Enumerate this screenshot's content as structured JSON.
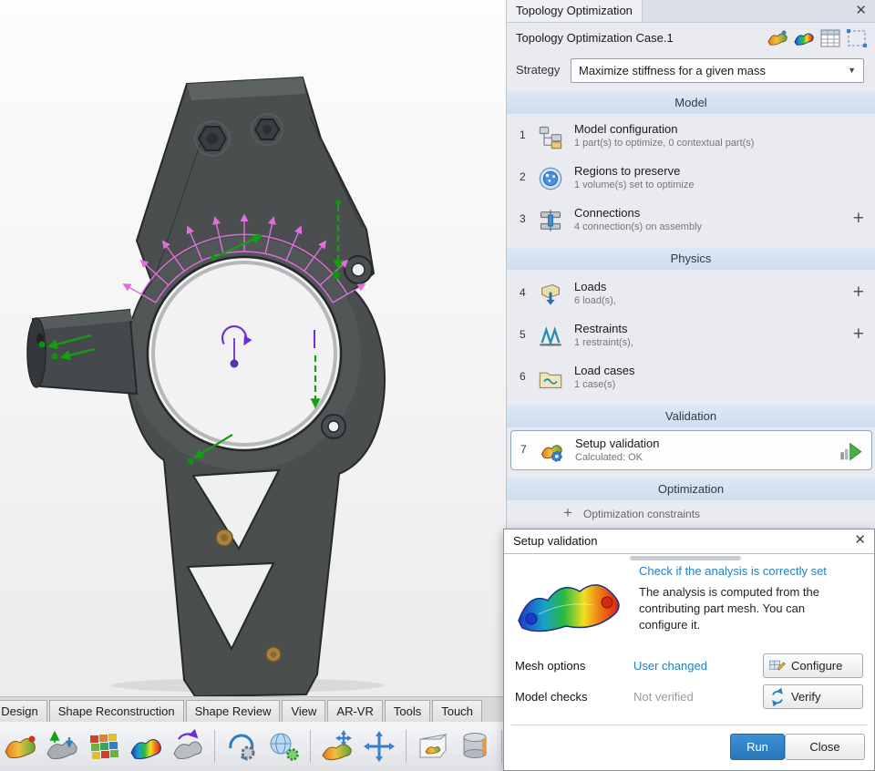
{
  "icons": {
    "close": "✕",
    "dropdown_arrow": "▼",
    "plus": "+"
  },
  "panel": {
    "title": "Topology Optimization",
    "case_title": "Topology Optimization Case.1",
    "strategy_label": "Strategy",
    "strategy_value": "Maximize stiffness for a given mass",
    "sections": {
      "model": {
        "title": "Model"
      },
      "physics": {
        "title": "Physics"
      },
      "validation": {
        "title": "Validation"
      },
      "optimization": {
        "title": "Optimization"
      }
    },
    "items": [
      {
        "num": "1",
        "label": "Model configuration",
        "sub": "1 part(s) to optimize, 0 contextual part(s)"
      },
      {
        "num": "2",
        "label": "Regions to preserve",
        "sub": "1 volume(s) set to optimize"
      },
      {
        "num": "3",
        "label": "Connections",
        "sub": "4 connection(s) on assembly"
      },
      {
        "num": "4",
        "label": "Loads",
        "sub": "6 load(s),"
      },
      {
        "num": "5",
        "label": "Restraints",
        "sub": "1 restraint(s),"
      },
      {
        "num": "6",
        "label": "Load cases",
        "sub": "1 case(s)"
      },
      {
        "num": "7",
        "label": "Setup validation",
        "sub": "Calculated: OK"
      }
    ],
    "constraints_label": "Optimization constraints"
  },
  "dialog": {
    "title": "Setup validation",
    "headline": "Check if the analysis is correctly set",
    "body": "The analysis is computed from the contributing part mesh. You can configure it.",
    "mesh_options_label": "Mesh options",
    "mesh_options_status": "User changed",
    "configure_label": "Configure",
    "model_checks_label": "Model checks",
    "model_checks_status": "Not verified",
    "verify_label": "Verify",
    "run_label": "Run",
    "close_label": "Close"
  },
  "tabbar": {
    "tabs": [
      "t Design",
      "Shape Reconstruction",
      "Shape Review",
      "View",
      "AR-VR",
      "Tools",
      "Touch"
    ]
  },
  "colors": {
    "accent_blue": "#2e7fc2",
    "link_blue": "#1f7fc0",
    "load_pink": "#e06edd",
    "load_green": "#12a012",
    "moment_purple": "#6f2fd8"
  }
}
